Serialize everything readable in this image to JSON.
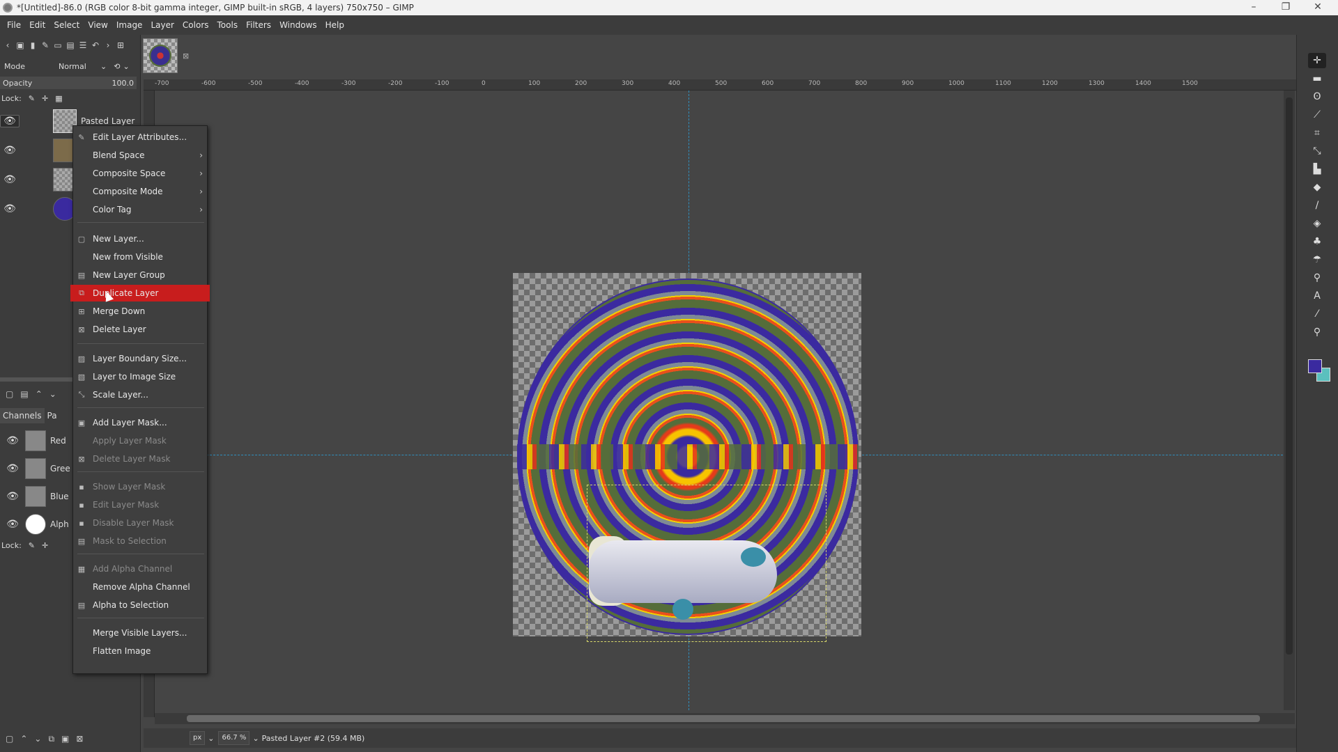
{
  "window": {
    "title": "*[Untitled]-86.0 (RGB color 8-bit gamma integer, GIMP built-in sRGB, 4 layers) 750x750 – GIMP",
    "minimize": "–",
    "restore": "❐",
    "close": "✕"
  },
  "menubar": [
    "File",
    "Edit",
    "Select",
    "View",
    "Image",
    "Layer",
    "Colors",
    "Tools",
    "Filters",
    "Windows",
    "Help"
  ],
  "layers_panel": {
    "mode_label": "Mode",
    "mode_value": "Normal",
    "opacity_label": "Opacity",
    "opacity_value": "100.0",
    "lock_label": "Lock:",
    "layers": [
      {
        "name": "Pasted Layer"
      },
      {
        "name": ""
      },
      {
        "name": ""
      },
      {
        "name": ""
      }
    ]
  },
  "channels_panel": {
    "tabs": [
      "Channels",
      "Pa"
    ],
    "channels": [
      {
        "name": "Red"
      },
      {
        "name": "Gree"
      },
      {
        "name": "Blue"
      },
      {
        "name": "Alph"
      }
    ],
    "lock_label": "Lock:"
  },
  "ruler": {
    "labels": [
      "-700",
      "-600",
      "-500",
      "-400",
      "-300",
      "-200",
      "-100",
      "0",
      "100",
      "200",
      "300",
      "400",
      "500",
      "600",
      "700",
      "800",
      "900",
      "1000",
      "1100",
      "1200",
      "1300",
      "1400",
      "1500"
    ]
  },
  "context_menu": {
    "items": [
      {
        "label": "Edit Layer Attributes...",
        "icon": "pencil-icon",
        "enabled": true
      },
      {
        "label": "Blend Space",
        "submenu": true,
        "enabled": true
      },
      {
        "label": "Composite Space",
        "submenu": true,
        "enabled": true
      },
      {
        "label": "Composite Mode",
        "submenu": true,
        "enabled": true
      },
      {
        "label": "Color Tag",
        "submenu": true,
        "enabled": true
      },
      {
        "label": "New Layer...",
        "icon": "new-layer-icon",
        "enabled": true
      },
      {
        "label": "New from Visible",
        "enabled": true
      },
      {
        "label": "New Layer Group",
        "icon": "folder-icon",
        "enabled": true
      },
      {
        "label": "Duplicate Layer",
        "icon": "duplicate-icon",
        "enabled": true,
        "highlighted": true
      },
      {
        "label": "Merge Down",
        "icon": "merge-down-icon",
        "enabled": true
      },
      {
        "label": "Delete Layer",
        "icon": "delete-icon",
        "enabled": true
      },
      {
        "label": "Layer Boundary Size...",
        "icon": "boundary-icon",
        "enabled": true
      },
      {
        "label": "Layer to Image Size",
        "icon": "image-size-icon",
        "enabled": true
      },
      {
        "label": "Scale Layer...",
        "icon": "scale-icon",
        "enabled": true
      },
      {
        "label": "Add Layer Mask...",
        "icon": "mask-icon",
        "enabled": true
      },
      {
        "label": "Apply Layer Mask",
        "enabled": false
      },
      {
        "label": "Delete Layer Mask",
        "icon": "delete-icon",
        "enabled": false
      },
      {
        "label": "Show Layer Mask",
        "checkbox": true,
        "enabled": false
      },
      {
        "label": "Edit Layer Mask",
        "checkbox": true,
        "enabled": false
      },
      {
        "label": "Disable Layer Mask",
        "checkbox": true,
        "enabled": false
      },
      {
        "label": "Mask to Selection",
        "icon": "selection-icon",
        "enabled": false
      },
      {
        "label": "Add Alpha Channel",
        "icon": "alpha-icon",
        "enabled": false
      },
      {
        "label": "Remove Alpha Channel",
        "enabled": true
      },
      {
        "label": "Alpha to Selection",
        "icon": "selection-icon",
        "enabled": true
      },
      {
        "label": "Merge Visible Layers...",
        "enabled": true
      },
      {
        "label": "Flatten Image",
        "enabled": true
      }
    ]
  },
  "statusbar": {
    "unit": "px",
    "zoom": "66.7 %",
    "message": "Pasted Layer #2 (59.4 MB)"
  },
  "colors": {
    "foreground": "#3a2a9f",
    "background": "#5bc0be",
    "menu_highlight": "#c81d1d",
    "guide": "#2f8fbf"
  }
}
